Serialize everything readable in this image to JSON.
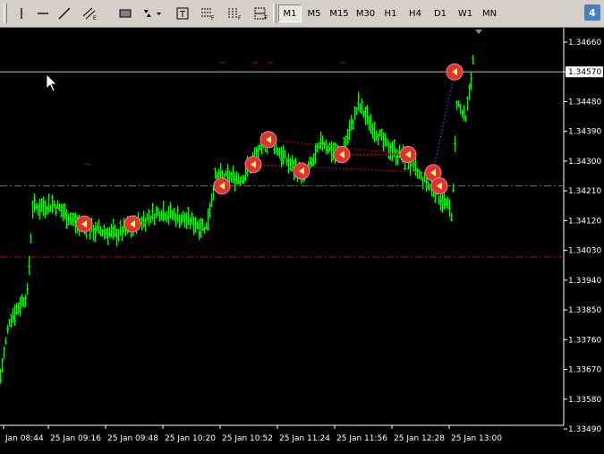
{
  "toolbar": {
    "tools": [
      {
        "name": "cursor-tool"
      },
      {
        "name": "vertical-line-tool"
      },
      {
        "name": "horizontal-line-tool"
      },
      {
        "name": "trendline-tool"
      },
      {
        "name": "equidistant-channel-tool"
      },
      {
        "name": "rectangle-tool"
      },
      {
        "name": "arrows-dropdown-tool"
      },
      {
        "name": "text-label-tool"
      },
      {
        "name": "fibonacci-retracement-tool"
      },
      {
        "name": "fibonacci-fan-tool"
      },
      {
        "name": "fibonacci-expansion-tool"
      }
    ],
    "timeframes": [
      "M1",
      "M5",
      "M15",
      "M30",
      "H1",
      "H4",
      "D1",
      "W1",
      "MN"
    ],
    "active_timeframe": "M1",
    "badge": "4"
  },
  "chart": {
    "price_labels": [
      "1.34660",
      "1.34570",
      "1.34480",
      "1.34390",
      "1.34300",
      "1.34210",
      "1.34120",
      "1.34030",
      "1.33940",
      "1.33850",
      "1.33760",
      "1.33670",
      "1.33580",
      "1.33490"
    ],
    "current_price": "1.34570",
    "time_labels": [
      "Jan 08:44",
      "25 Jan 09:16",
      "25 Jan 09:48",
      "25 Jan 10:20",
      "25 Jan 10:52",
      "25 Jan 11:24",
      "25 Jan 11:56",
      "25 Jan 12:28",
      "25 Jan 13:00"
    ],
    "colors": {
      "background": "#000000",
      "bars": "#00ff00",
      "axis_text": "#ffffff",
      "bid_line": "#c0c0c0",
      "level_green": "#6b8e23",
      "level_red": "#cc0000",
      "trade_marker": "#e0303a"
    }
  }
}
